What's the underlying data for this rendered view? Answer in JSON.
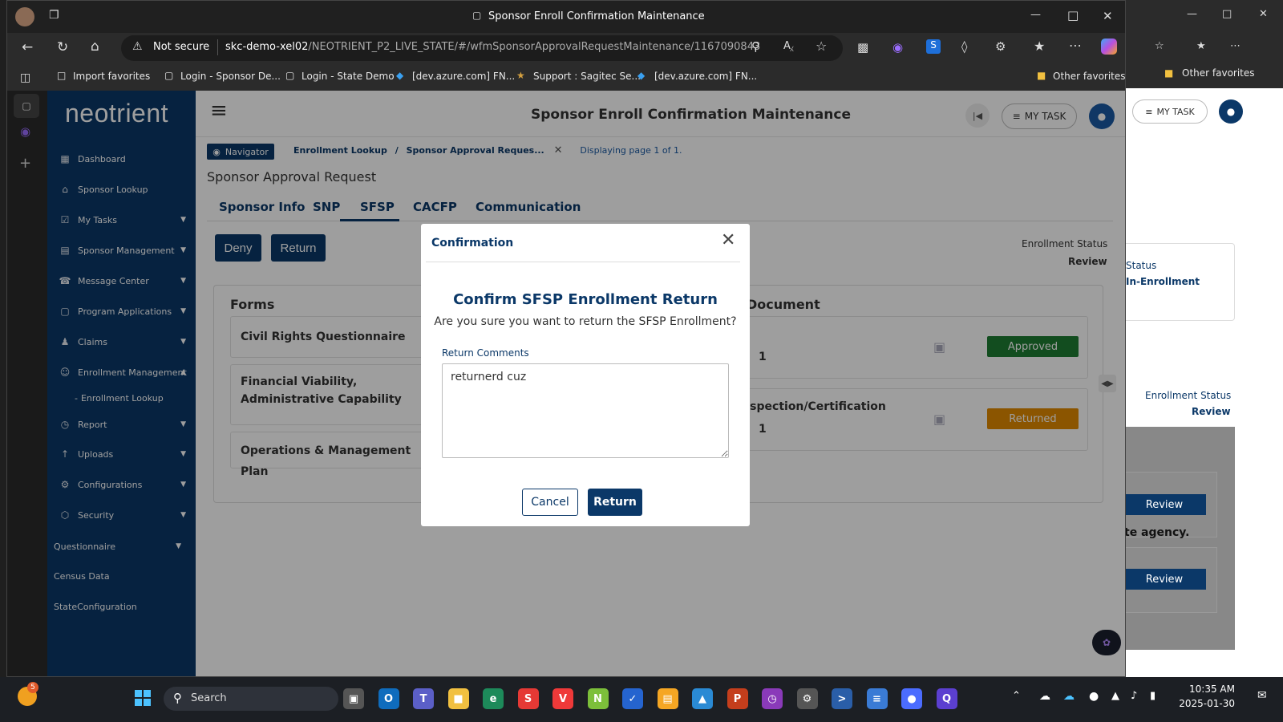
{
  "browser": {
    "window_title": "Sponsor Enroll Confirmation Maintenance",
    "security_label": "Not secure",
    "url_host": "skc-demo-xel02",
    "url_path": "/NEOTRIENT_P2_LIVE_STATE/#/wfmSponsorApprovalRequestMaintenance/1167090843",
    "favorites": [
      "Import favorites",
      "Login - Sponsor De...",
      "Login - State Demo",
      "[dev.azure.com] FN...",
      "Support : Sagitec Se...",
      "[dev.azure.com] FN..."
    ],
    "other_favorites": "Other favorites"
  },
  "app": {
    "logo": "neotrient",
    "header_title": "Sponsor Enroll Confirmation Maintenance",
    "my_task": "MY TASK",
    "sidebar": [
      {
        "label": "Dashboard",
        "icon": "dashboard-icon",
        "chevron": false
      },
      {
        "label": "Sponsor Lookup",
        "icon": "building-icon",
        "chevron": false
      },
      {
        "label": "My Tasks",
        "icon": "tasks-icon",
        "chevron": true
      },
      {
        "label": "Sponsor Management",
        "icon": "management-icon",
        "chevron": true
      },
      {
        "label": "Message Center",
        "icon": "phone-icon",
        "chevron": true
      },
      {
        "label": "Program Applications",
        "icon": "folder-icon",
        "chevron": true
      },
      {
        "label": "Claims",
        "icon": "claims-icon",
        "chevron": true
      },
      {
        "label": "Enrollment Management",
        "icon": "user-icon",
        "chevron": true
      },
      {
        "label": "Enrollment Lookup",
        "icon": "",
        "chevron": false
      },
      {
        "label": "Report",
        "icon": "clock-icon",
        "chevron": true
      },
      {
        "label": "Uploads",
        "icon": "upload-icon",
        "chevron": true
      },
      {
        "label": "Configurations",
        "icon": "gear-icon",
        "chevron": true
      },
      {
        "label": "Security",
        "icon": "shield-icon",
        "chevron": true
      },
      {
        "label": "Questionnaire",
        "icon": "",
        "chevron": true
      },
      {
        "label": "Census Data",
        "icon": "",
        "chevron": false
      },
      {
        "label": "StateConfiguration",
        "icon": "",
        "chevron": false
      }
    ],
    "breadcrumb": {
      "navigator": "Navigator",
      "item1": "Enrollment Lookup",
      "sep": "/",
      "item2": "Sponsor Approval Reques...",
      "paging": "Displaying page 1 of 1."
    },
    "page_title": "Sponsor Approval Request",
    "tabs": [
      "Sponsor Info",
      "SNP",
      "SFSP",
      "CACFP",
      "Communication"
    ],
    "actions": {
      "deny": "Deny",
      "return": "Return"
    },
    "enrollment_status_label": "Enrollment Status",
    "enrollment_status_value": "Review",
    "forms_heading": "Forms",
    "forms": [
      "Civil Rights Questionnaire",
      "Financial Viability, Administrative Capability",
      "Operations & Management Plan"
    ],
    "documents_heading": "Document",
    "documents": [
      {
        "name": "",
        "count": "1",
        "status": "Approved",
        "color": "#1e7d32"
      },
      {
        "name": "Inspection/Certification",
        "count": "1",
        "status": "Returned",
        "color": "#e08a00"
      }
    ]
  },
  "background_window": {
    "my_task": "MY TASK",
    "status_label": "Status",
    "status_value": "In-Enrollment",
    "enrollment_status_label": "Enrollment Status",
    "enrollment_status_value": "Review",
    "review_btn1": "Review",
    "text": "te agency.",
    "review_btn2": "Review",
    "other_favorites": "Other favorites"
  },
  "modal": {
    "title": "Confirmation",
    "heading": "Confirm SFSP Enrollment Return",
    "message": "Are you sure you want to return the SFSP Enrollment?",
    "comments_label": "Return Comments",
    "comments_value": "returnerd cuz",
    "cancel": "Cancel",
    "return": "Return"
  },
  "taskbar": {
    "search": "Search",
    "time": "10:35 AM",
    "date": "2025-01-30",
    "weather_badge": "5"
  }
}
